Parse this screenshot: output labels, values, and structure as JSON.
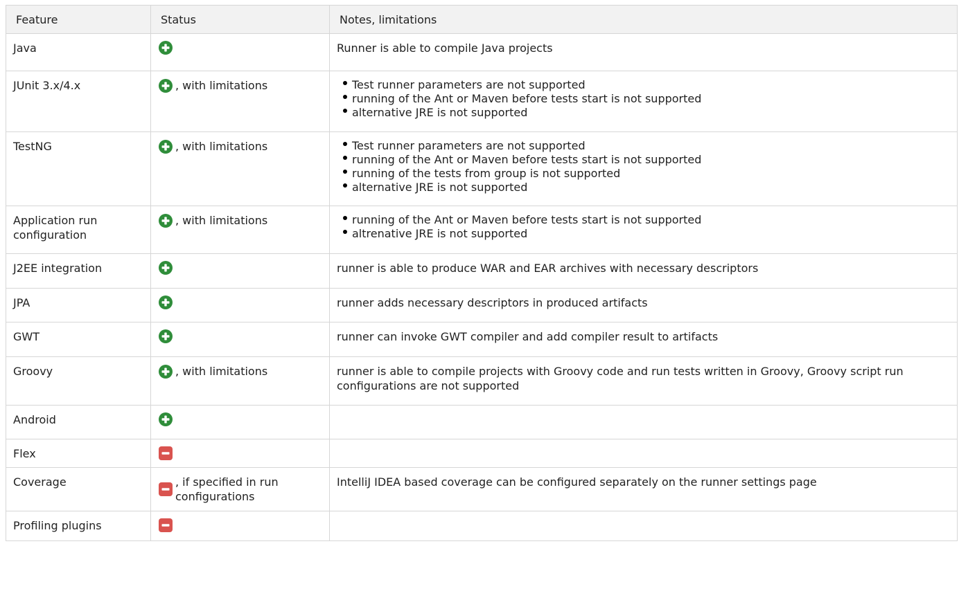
{
  "headers": [
    "Feature",
    "Status",
    "Notes, limitations"
  ],
  "colors": {
    "supported": "#2f8d3a",
    "unsupported": "#d9534f",
    "header_bg": "#f2f2f2",
    "border": "#d6d6d6"
  },
  "rows": [
    {
      "feature": "Java",
      "status_icon": "plus-circle-icon",
      "status_text": "",
      "notes_text": "Runner is able to compile Java projects",
      "notes_list": []
    },
    {
      "feature": "JUnit 3.x/4.x",
      "status_icon": "plus-circle-icon",
      "status_text": ", with limitations",
      "notes_text": "",
      "notes_list": [
        "Test runner parameters are not supported",
        "running of the Ant or Maven before tests start is not supported",
        "alternative JRE is not supported"
      ]
    },
    {
      "feature": "TestNG",
      "status_icon": "plus-circle-icon",
      "status_text": ", with limitations",
      "notes_text": "",
      "notes_list": [
        "Test runner parameters are not supported",
        "running of the Ant or Maven before tests start is not supported",
        "running of the tests from group is not supported",
        "alternative JRE is not supported"
      ]
    },
    {
      "feature": "Application run configuration",
      "status_icon": "plus-circle-icon",
      "status_text": ", with limitations",
      "notes_text": "",
      "notes_list": [
        "running of the Ant or Maven before tests start is not supported",
        "altrenative JRE is not supported"
      ]
    },
    {
      "feature": "J2EE integration",
      "status_icon": "plus-circle-icon",
      "status_text": "",
      "notes_text": "runner is able to produce WAR and EAR archives with necessary descriptors",
      "notes_list": []
    },
    {
      "feature": "JPA",
      "status_icon": "plus-circle-icon",
      "status_text": "",
      "notes_text": "runner adds necessary descriptors in produced artifacts",
      "notes_list": []
    },
    {
      "feature": "GWT",
      "status_icon": "plus-circle-icon",
      "status_text": "",
      "notes_text": "runner can invoke GWT compiler and add compiler result to artifacts",
      "notes_list": []
    },
    {
      "feature": "Groovy",
      "status_icon": "plus-circle-icon",
      "status_text": ", with limitations",
      "notes_text": "runner is able to compile projects with Groovy code and run tests written in Groovy, Groovy script run configurations are not supported",
      "notes_list": []
    },
    {
      "feature": "Android",
      "status_icon": "plus-circle-icon",
      "status_text": "",
      "notes_text": "",
      "notes_list": []
    },
    {
      "feature": "Flex",
      "status_icon": "minus-square-icon",
      "status_text": "",
      "notes_text": "",
      "notes_list": []
    },
    {
      "feature": "Coverage",
      "status_icon": "minus-square-icon",
      "status_text": ", if specified in run configurations",
      "notes_text": "IntelliJ IDEA based coverage can be configured separately on the runner settings page",
      "notes_list": []
    },
    {
      "feature": "Profiling plugins",
      "status_icon": "minus-square-icon",
      "status_text": "",
      "notes_text": "",
      "notes_list": []
    }
  ]
}
